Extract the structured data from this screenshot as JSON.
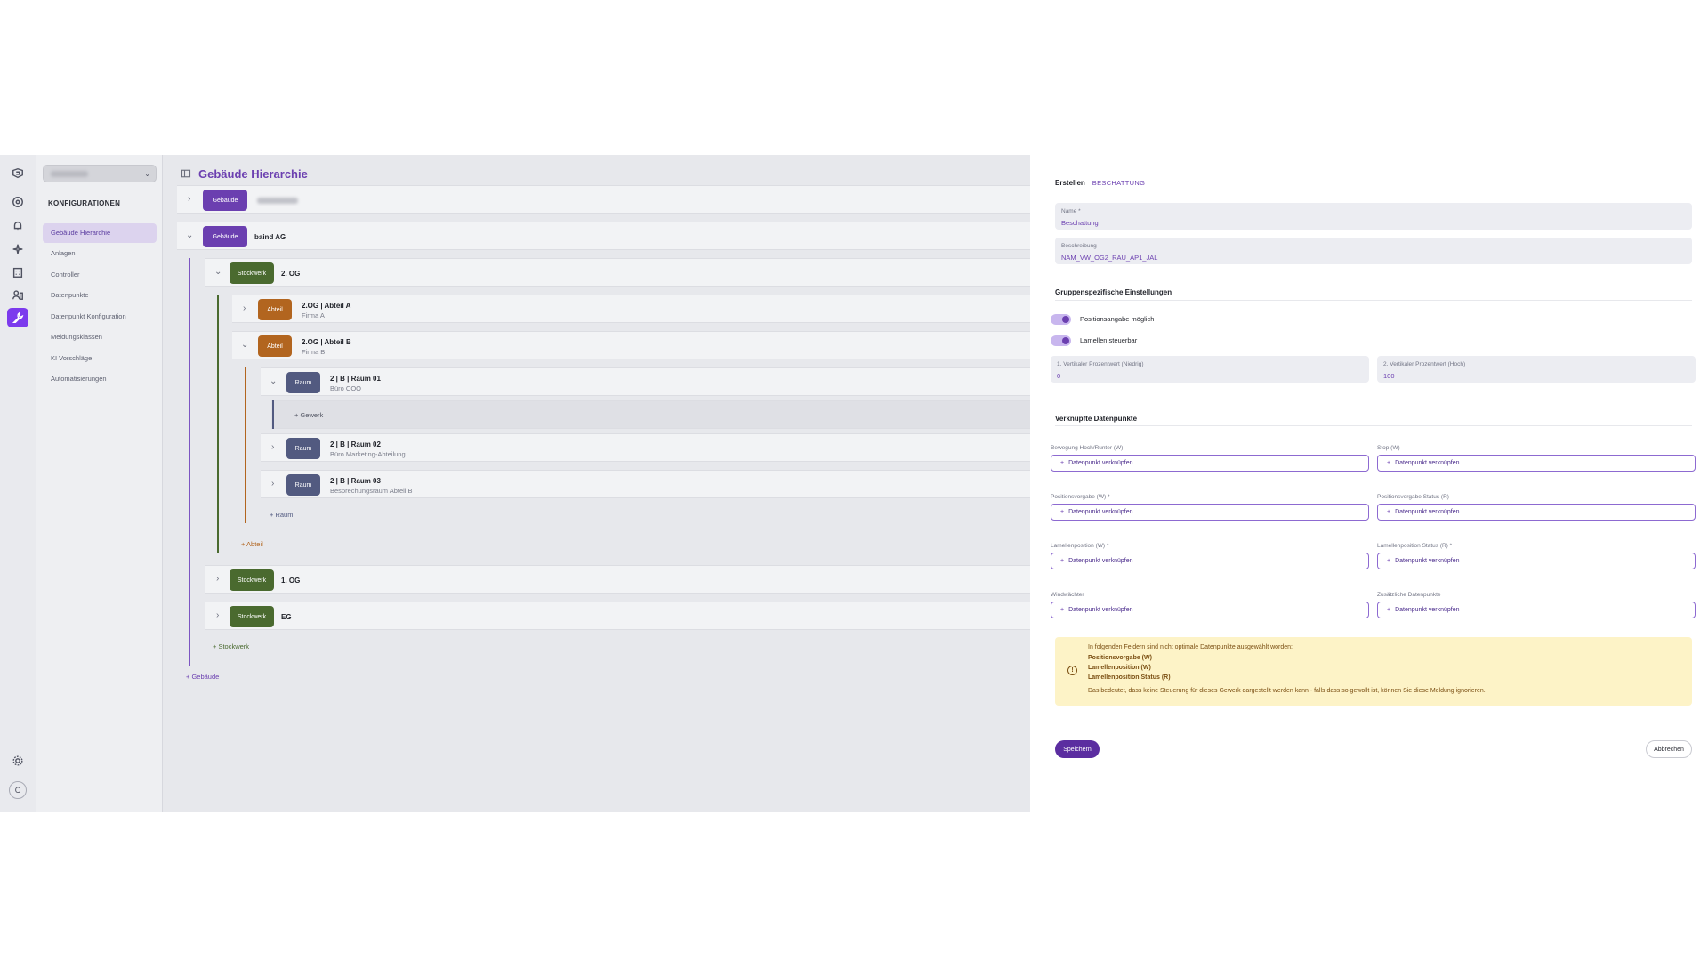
{
  "sidebar": {
    "heading": "KONFIGURATIONEN",
    "items": [
      {
        "label": "Gebäude Hierarchie"
      },
      {
        "label": "Anlagen"
      },
      {
        "label": "Controller"
      },
      {
        "label": "Datenpunkte"
      },
      {
        "label": "Datenpunkt Konfiguration"
      },
      {
        "label": "Meldungsklassen"
      },
      {
        "label": "KI Vorschläge"
      },
      {
        "label": "Automatisierungen"
      }
    ],
    "avatar_initial": "C"
  },
  "main": {
    "title": "Gebäude Hierarchie",
    "tree": {
      "building_1": {
        "badge": "Gebäude"
      },
      "building_2": {
        "badge": "Gebäude",
        "name": "baind AG"
      },
      "floor_2og": {
        "badge": "Stockwerk",
        "name": "2. OG"
      },
      "abteil_a": {
        "badge": "Abteil",
        "name": "2.OG | Abteil A",
        "sub": "Firma A"
      },
      "abteil_b": {
        "badge": "Abteil",
        "name": "2.OG | Abteil B",
        "sub": "Firma B"
      },
      "raum_01": {
        "badge": "Raum",
        "name": "2 | B | Raum 01",
        "sub": "Büro COO"
      },
      "add_gewerk": "+ Gewerk",
      "raum_02": {
        "badge": "Raum",
        "name": "2 | B | Raum 02",
        "sub": "Büro Marketing-Abteilung"
      },
      "raum_03": {
        "badge": "Raum",
        "name": "2 | B | Raum 03",
        "sub": "Besprechungsraum Abteil B"
      },
      "add_raum": "+ Raum",
      "add_abteil": "+ Abteil",
      "floor_1og": {
        "badge": "Stockwerk",
        "name": "1. OG"
      },
      "floor_eg": {
        "badge": "Stockwerk",
        "name": "EG"
      },
      "add_stockwerk": "+ Stockwerk",
      "add_gebaeude": "+ Gebäude"
    }
  },
  "panel": {
    "tab_create": "Erstellen",
    "tab_type": "BESCHATTUNG",
    "name_label": "Name *",
    "name_value": "Beschattung",
    "desc_label": "Beschreibung",
    "desc_value": "NAM_VW_OG2_RAU_AP1_JAL",
    "group_title": "Gruppenspezifische Einstellungen",
    "toggle_position": "Positionsangabe möglich",
    "toggle_lamellen": "Lamellen steuerbar",
    "pct_low_label": "1. Vertikaler Prozentwert (Niedrig)",
    "pct_low_value": "0",
    "pct_high_label": "2. Vertikaler Prozentwert (Hoch)",
    "pct_high_value": "100",
    "linked_title": "Verknüpfte Datenpunkte",
    "link_button": "Datenpunkt verknüpfen",
    "datapoints": [
      "Bewegung Hoch/Runter (W)",
      "Stop (W)",
      "Positionsvorgabe (W) *",
      "Positionsvorgabe Status (R)",
      "Lamellenposition (W) *",
      "Lamellenposition Status (R) *",
      "Windwächter",
      "Zusätzliche Datenpunkte"
    ],
    "warning": {
      "intro": "In folgenden Feldern sind nicht optimale Datenpunkte ausgewählt worden:",
      "items": [
        "Positionsvorgabe (W)",
        "Lamellenposition (W)",
        "Lamellenposition Status (R)"
      ],
      "note": "Das bedeutet, dass keine Steuerung für dieses Gewerk dargestellt werden kann - falls dass so gewollt ist, können Sie diese Meldung ignorieren."
    },
    "save": "Speichern",
    "cancel": "Abbrechen"
  },
  "colors": {
    "accent": "#6b3fb0",
    "building": "#6b3fb0",
    "floor": "#4a6a2f",
    "section": "#b2651f",
    "room": "#525a80",
    "warning_bg": "#fdf3c7"
  }
}
